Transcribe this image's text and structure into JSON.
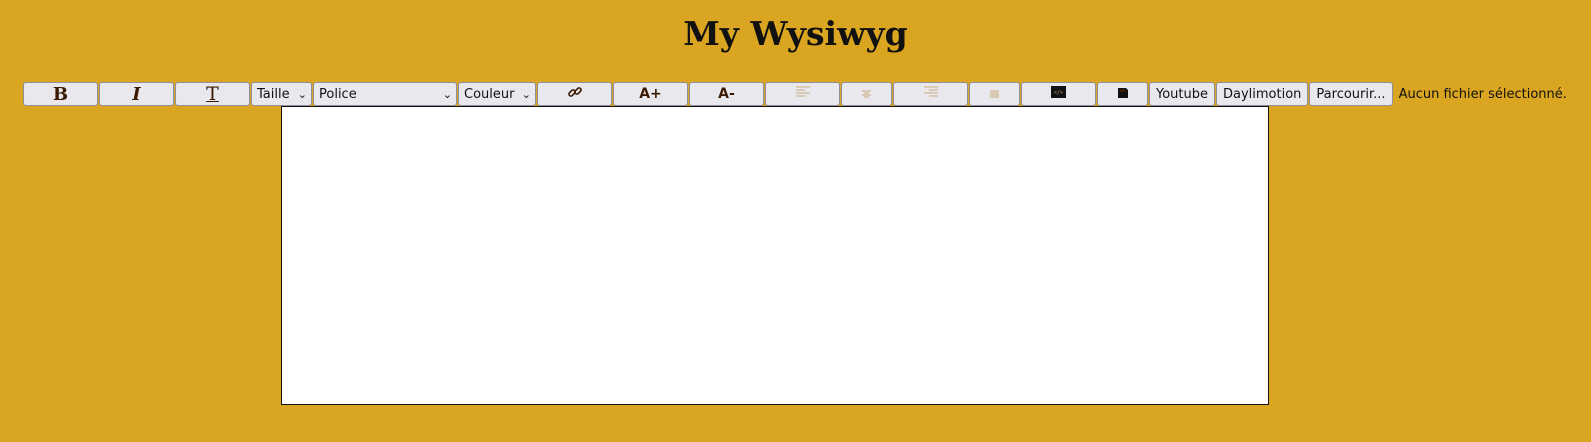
{
  "page": {
    "title": "My Wysiwyg"
  },
  "colors": {
    "background": "#DAA520",
    "button_bg": "#E9E9ED",
    "icon_brown": "#3A1A00",
    "editor_bg": "#FFFFFF"
  },
  "toolbar": {
    "bold_label": "B",
    "italic_label": "I",
    "underline_label": "T",
    "size_select": "Taille",
    "font_select": "Police",
    "color_select": "Couleur",
    "font_increase_label": "A+",
    "font_decrease_label": "A-",
    "youtube_label": "Youtube",
    "dailymotion_label": "Daylimotion",
    "browse_label": "Parcourir...",
    "file_status": "Aucun fichier sélectionné."
  },
  "icons": {
    "link": "link-icon",
    "align_left": "align-left-icon",
    "align_center": "align-center-icon",
    "align_right": "align-right-icon",
    "align_justify": "align-justify-icon",
    "code": "code-icon",
    "save": "save-icon"
  }
}
